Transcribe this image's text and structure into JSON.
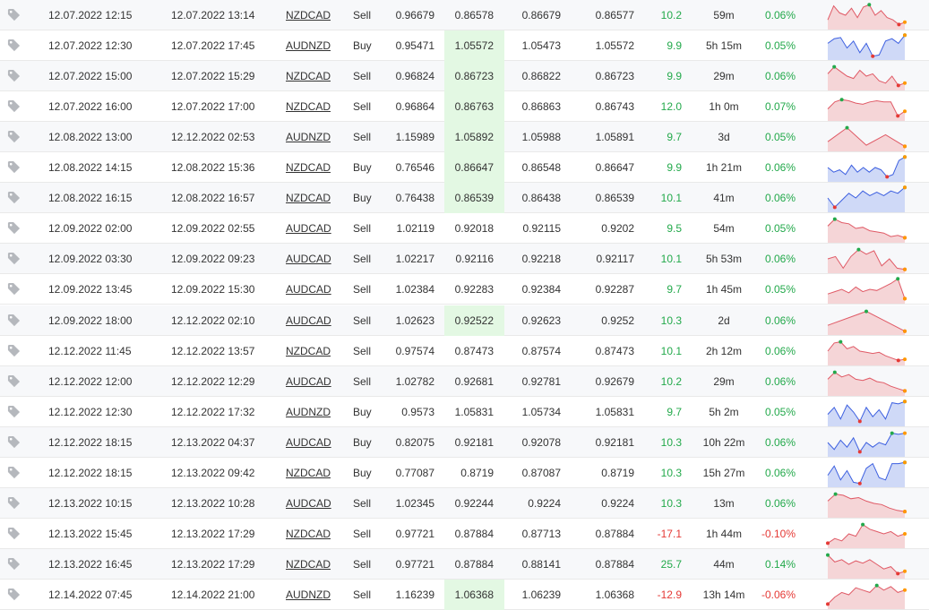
{
  "colors": {
    "positive": "#23a94b",
    "negative": "#e53935",
    "highlight": "#e3f8e3",
    "sell_fill": "#f5d5d7",
    "sell_line": "#e05a66",
    "buy_fill": "#cfd9f7",
    "buy_line": "#3c5fe0",
    "marker_high": "#23a94b",
    "marker_low": "#e53935",
    "marker_last": "#ff9800"
  },
  "rows": [
    {
      "open": "12.07.2022 12:15",
      "close": "12.07.2022 13:14",
      "symbol": "NZDCAD",
      "type": "Sell",
      "v1": "0.96679",
      "v2": "0.86578",
      "v3": "0.86679",
      "v4": "0.86577",
      "pips": "10.2",
      "duration": "59m",
      "pct": "0.06%",
      "positive": true,
      "highlight": false,
      "spark": [
        0.3,
        0.9,
        0.6,
        0.5,
        0.8,
        0.4,
        0.85,
        0.95,
        0.5,
        0.7,
        0.4,
        0.3,
        0.1,
        0.2
      ]
    },
    {
      "open": "12.07.2022 12:30",
      "close": "12.07.2022 17:45",
      "symbol": "AUDNZD",
      "type": "Buy",
      "v1": "0.95471",
      "v2": "1.05572",
      "v3": "1.05473",
      "v4": "1.05572",
      "pips": "9.9",
      "duration": "5h 15m",
      "pct": "0.05%",
      "positive": true,
      "highlight": true,
      "spark": [
        0.6,
        0.8,
        0.85,
        0.4,
        0.7,
        0.2,
        0.6,
        0.05,
        0.1,
        0.7,
        0.8,
        0.6,
        0.95
      ]
    },
    {
      "open": "12.07.2022 15:00",
      "close": "12.07.2022 15:29",
      "symbol": "NZDCAD",
      "type": "Sell",
      "v1": "0.96824",
      "v2": "0.86723",
      "v3": "0.86822",
      "v4": "0.86723",
      "pips": "9.9",
      "duration": "29m",
      "pct": "0.06%",
      "positive": true,
      "highlight": true,
      "spark": [
        0.6,
        0.9,
        0.7,
        0.5,
        0.4,
        0.75,
        0.5,
        0.6,
        0.3,
        0.2,
        0.5,
        0.1,
        0.2
      ]
    },
    {
      "open": "12.07.2022 16:00",
      "close": "12.07.2022 17:00",
      "symbol": "NZDCAD",
      "type": "Sell",
      "v1": "0.96864",
      "v2": "0.86763",
      "v3": "0.86863",
      "v4": "0.86743",
      "pips": "12.0",
      "duration": "1h 0m",
      "pct": "0.07%",
      "positive": true,
      "highlight": true,
      "spark": [
        0.4,
        0.7,
        0.8,
        0.75,
        0.65,
        0.6,
        0.7,
        0.75,
        0.7,
        0.7,
        0.1,
        0.3
      ]
    },
    {
      "open": "12.08.2022 13:00",
      "close": "12.12.2022 02:53",
      "symbol": "AUDNZD",
      "type": "Sell",
      "v1": "1.15989",
      "v2": "1.05892",
      "v3": "1.05988",
      "v4": "1.05891",
      "pips": "9.7",
      "duration": "3d",
      "pct": "0.05%",
      "positive": true,
      "highlight": true,
      "spark": [
        0.3,
        0.9,
        0.15,
        0.6,
        0.1
      ]
    },
    {
      "open": "12.08.2022 14:15",
      "close": "12.08.2022 15:36",
      "symbol": "NZDCAD",
      "type": "Buy",
      "v1": "0.76546",
      "v2": "0.86647",
      "v3": "0.86548",
      "v4": "0.86647",
      "pips": "9.9",
      "duration": "1h 21m",
      "pct": "0.06%",
      "positive": true,
      "highlight": true,
      "spark": [
        0.5,
        0.3,
        0.4,
        0.2,
        0.6,
        0.3,
        0.5,
        0.3,
        0.5,
        0.4,
        0.1,
        0.2,
        0.8,
        0.95
      ]
    },
    {
      "open": "12.08.2022 16:15",
      "close": "12.08.2022 16:57",
      "symbol": "NZDCAD",
      "type": "Buy",
      "v1": "0.76438",
      "v2": "0.86539",
      "v3": "0.86438",
      "v4": "0.86539",
      "pips": "10.1",
      "duration": "41m",
      "pct": "0.06%",
      "positive": true,
      "highlight": true,
      "spark": [
        0.5,
        0.1,
        0.4,
        0.7,
        0.5,
        0.8,
        0.6,
        0.75,
        0.6,
        0.8,
        0.7,
        0.95
      ]
    },
    {
      "open": "12.09.2022 02:00",
      "close": "12.09.2022 02:55",
      "symbol": "AUDCAD",
      "type": "Sell",
      "v1": "1.02119",
      "v2": "0.92018",
      "v3": "0.92115",
      "v4": "0.9202",
      "pips": "9.5",
      "duration": "54m",
      "pct": "0.05%",
      "positive": true,
      "highlight": false,
      "spark": [
        0.6,
        0.9,
        0.75,
        0.7,
        0.5,
        0.55,
        0.4,
        0.35,
        0.3,
        0.15,
        0.2,
        0.1
      ]
    },
    {
      "open": "12.09.2022 03:30",
      "close": "12.09.2022 09:23",
      "symbol": "AUDCAD",
      "type": "Sell",
      "v1": "1.02217",
      "v2": "0.92116",
      "v3": "0.92218",
      "v4": "0.92117",
      "pips": "10.1",
      "duration": "5h 53m",
      "pct": "0.06%",
      "positive": true,
      "highlight": false,
      "spark": [
        0.5,
        0.6,
        0.1,
        0.6,
        0.9,
        0.7,
        0.85,
        0.2,
        0.5,
        0.1,
        0.05
      ]
    },
    {
      "open": "12.09.2022 13:45",
      "close": "12.09.2022 15:30",
      "symbol": "AUDCAD",
      "type": "Sell",
      "v1": "1.02384",
      "v2": "0.92283",
      "v3": "0.92384",
      "v4": "0.92287",
      "pips": "9.7",
      "duration": "1h 45m",
      "pct": "0.05%",
      "positive": true,
      "highlight": false,
      "spark": [
        0.3,
        0.4,
        0.5,
        0.35,
        0.6,
        0.4,
        0.5,
        0.45,
        0.6,
        0.75,
        0.95,
        0.1
      ]
    },
    {
      "open": "12.09.2022 18:00",
      "close": "12.12.2022 02:10",
      "symbol": "AUDCAD",
      "type": "Sell",
      "v1": "1.02623",
      "v2": "0.92522",
      "v3": "0.92623",
      "v4": "0.9252",
      "pips": "10.3",
      "duration": "2d",
      "pct": "0.06%",
      "positive": true,
      "highlight": true,
      "spark": [
        0.3,
        0.9,
        0.05
      ]
    },
    {
      "open": "12.12.2022 11:45",
      "close": "12.12.2022 13:57",
      "symbol": "NZDCAD",
      "type": "Sell",
      "v1": "0.97574",
      "v2": "0.87473",
      "v3": "0.87574",
      "v4": "0.87473",
      "pips": "10.1",
      "duration": "2h 12m",
      "pct": "0.06%",
      "positive": true,
      "highlight": false,
      "spark": [
        0.5,
        0.85,
        0.9,
        0.6,
        0.7,
        0.5,
        0.45,
        0.4,
        0.45,
        0.3,
        0.2,
        0.1,
        0.15
      ]
    },
    {
      "open": "12.12.2022 12:00",
      "close": "12.12.2022 12:29",
      "symbol": "AUDCAD",
      "type": "Sell",
      "v1": "1.02782",
      "v2": "0.92681",
      "v3": "0.92781",
      "v4": "0.92679",
      "pips": "10.2",
      "duration": "29m",
      "pct": "0.06%",
      "positive": true,
      "highlight": false,
      "spark": [
        0.6,
        0.9,
        0.7,
        0.8,
        0.6,
        0.55,
        0.65,
        0.5,
        0.45,
        0.3,
        0.2,
        0.1
      ]
    },
    {
      "open": "12.12.2022 12:30",
      "close": "12.12.2022 17:32",
      "symbol": "AUDNZD",
      "type": "Buy",
      "v1": "0.9573",
      "v2": "1.05831",
      "v3": "1.05734",
      "v4": "1.05831",
      "pips": "9.7",
      "duration": "5h 2m",
      "pct": "0.05%",
      "positive": true,
      "highlight": false,
      "spark": [
        0.4,
        0.7,
        0.2,
        0.8,
        0.5,
        0.1,
        0.7,
        0.3,
        0.6,
        0.2,
        0.9,
        0.85,
        0.95
      ]
    },
    {
      "open": "12.12.2022 18:15",
      "close": "12.13.2022 04:37",
      "symbol": "AUDCAD",
      "type": "Buy",
      "v1": "0.82075",
      "v2": "0.92181",
      "v3": "0.92078",
      "v4": "0.92181",
      "pips": "10.3",
      "duration": "10h 22m",
      "pct": "0.06%",
      "positive": true,
      "highlight": false,
      "spark": [
        0.5,
        0.2,
        0.6,
        0.3,
        0.7,
        0.1,
        0.5,
        0.3,
        0.5,
        0.4,
        0.9,
        0.85,
        0.9
      ]
    },
    {
      "open": "12.12.2022 18:15",
      "close": "12.13.2022 09:42",
      "symbol": "NZDCAD",
      "type": "Buy",
      "v1": "0.77087",
      "v2": "0.8719",
      "v3": "0.87087",
      "v4": "0.8719",
      "pips": "10.3",
      "duration": "15h 27m",
      "pct": "0.06%",
      "positive": true,
      "highlight": false,
      "spark": [
        0.4,
        0.8,
        0.2,
        0.6,
        0.1,
        0.05,
        0.7,
        0.9,
        0.3,
        0.2,
        0.9,
        0.9,
        0.95
      ]
    },
    {
      "open": "12.13.2022 10:15",
      "close": "12.13.2022 10:28",
      "symbol": "AUDCAD",
      "type": "Sell",
      "v1": "1.02345",
      "v2": "0.92244",
      "v3": "0.9224",
      "v4": "0.9224",
      "pips": "10.3",
      "duration": "13m",
      "pct": "0.06%",
      "positive": true,
      "highlight": false,
      "spark": [
        0.6,
        0.9,
        0.85,
        0.7,
        0.75,
        0.6,
        0.5,
        0.45,
        0.3,
        0.2,
        0.15
      ]
    },
    {
      "open": "12.13.2022 15:45",
      "close": "12.13.2022 17:29",
      "symbol": "NZDCAD",
      "type": "Sell",
      "v1": "0.97721",
      "v2": "0.87884",
      "v3": "0.87713",
      "v4": "0.87884",
      "pips": "-17.1",
      "duration": "1h 44m",
      "pct": "-0.10%",
      "positive": false,
      "highlight": false,
      "spark": [
        0.1,
        0.3,
        0.2,
        0.5,
        0.4,
        0.9,
        0.7,
        0.6,
        0.5,
        0.6,
        0.4,
        0.5
      ]
    },
    {
      "open": "12.13.2022 16:45",
      "close": "12.13.2022 17:29",
      "symbol": "NZDCAD",
      "type": "Sell",
      "v1": "0.97721",
      "v2": "0.87884",
      "v3": "0.88141",
      "v4": "0.87884",
      "pips": "25.7",
      "duration": "44m",
      "pct": "0.14%",
      "positive": true,
      "highlight": false,
      "spark": [
        0.9,
        0.6,
        0.7,
        0.5,
        0.65,
        0.55,
        0.7,
        0.5,
        0.3,
        0.4,
        0.1,
        0.2
      ]
    },
    {
      "open": "12.14.2022 07:45",
      "close": "12.14.2022 21:00",
      "symbol": "AUDNZD",
      "type": "Sell",
      "v1": "1.16239",
      "v2": "1.06368",
      "v3": "1.06239",
      "v4": "1.06368",
      "pips": "-12.9",
      "duration": "13h 14m",
      "pct": "-0.06%",
      "positive": false,
      "highlight": true,
      "spark": [
        0.1,
        0.4,
        0.6,
        0.5,
        0.8,
        0.7,
        0.6,
        0.9,
        0.7,
        0.85,
        0.6,
        0.7
      ]
    }
  ]
}
